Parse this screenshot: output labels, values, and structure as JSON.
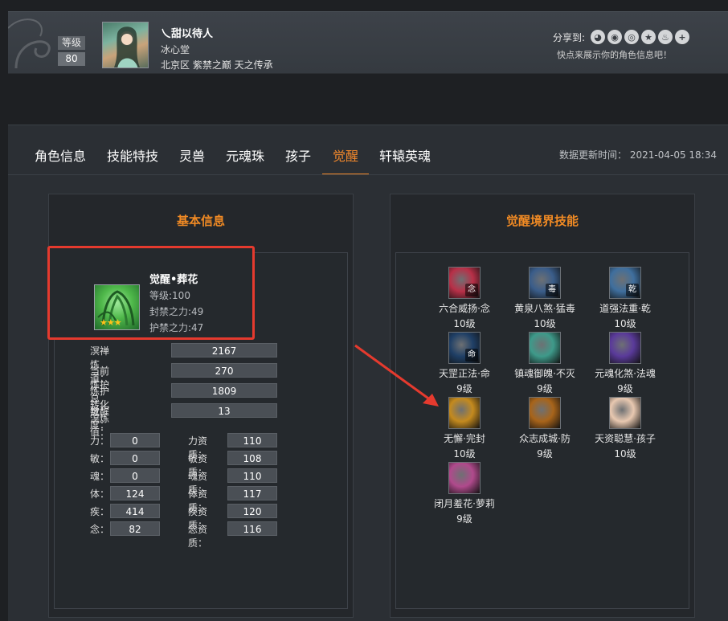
{
  "header": {
    "level_label": "等级",
    "level_value": "80",
    "player_name": "乀甜以待人",
    "guild": "冰心堂",
    "server": "北京区 紫禁之巅 天之传承",
    "share_label": "分享到:",
    "share_icons": [
      "wechat-icon",
      "qq-icon",
      "weibo-icon",
      "qzone-icon",
      "tieba-icon",
      "more-icon"
    ],
    "share_tip": "快点来展示你的角色信息吧！"
  },
  "tabs": [
    {
      "label": "角色信息"
    },
    {
      "label": "技能特技"
    },
    {
      "label": "灵兽"
    },
    {
      "label": "元魂珠"
    },
    {
      "label": "孩子"
    },
    {
      "label": "觉醒",
      "active": true
    },
    {
      "label": "轩辕英魂"
    }
  ],
  "update_time": "数据更新时间： 2021-04-05 18:34",
  "basic": {
    "title": "基本信息",
    "awaken_name": "觉醒•葬花",
    "awaken_level": "等级:100",
    "seal_power": "封禁之力:49",
    "guard_power": "护禁之力:47",
    "stats": [
      {
        "label": "溟禅炼道：",
        "value": "2167"
      },
      {
        "label": "当前炼护总数：",
        "value": "270"
      },
      {
        "label": "炼护转化溟炼值：",
        "value": "1809"
      },
      {
        "label": "觉醒度：",
        "value": "13"
      }
    ],
    "attrs_left": [
      {
        "label": "力：",
        "value": "0"
      },
      {
        "label": "敏：",
        "value": "0"
      },
      {
        "label": "魂：",
        "value": "0"
      },
      {
        "label": "体：",
        "value": "124"
      },
      {
        "label": "疾：",
        "value": "414"
      },
      {
        "label": "念：",
        "value": "82"
      }
    ],
    "attrs_right": [
      {
        "label": "力资质：",
        "value": "110"
      },
      {
        "label": "敏资质：",
        "value": "108"
      },
      {
        "label": "魂资质：",
        "value": "110"
      },
      {
        "label": "体资质：",
        "value": "117"
      },
      {
        "label": "疾资质：",
        "value": "120"
      },
      {
        "label": "念资质：",
        "value": "116"
      }
    ]
  },
  "skills": {
    "title": "觉醒境界技能",
    "items": [
      {
        "name": "六合威扬·念",
        "level": "10级",
        "glyph": "念",
        "color": "#b83048"
      },
      {
        "name": "黄泉八煞·猛毒",
        "level": "10级",
        "glyph": "毒",
        "color": "#3a5d8a"
      },
      {
        "name": "道强法重·乾",
        "level": "10级",
        "glyph": "乾",
        "color": "#3f6f9e"
      },
      {
        "name": "天罡正法·命",
        "level": "9级",
        "glyph": "命",
        "color": "#1f3f66"
      },
      {
        "name": "镇魂御魄·不灭",
        "level": "9级",
        "glyph": "",
        "color": "#3e9a8a"
      },
      {
        "name": "元魂化煞·法魂",
        "level": "9级",
        "glyph": "",
        "color": "#5a3a9a"
      },
      {
        "name": "无懈·完封",
        "level": "10级",
        "glyph": "",
        "color": "#c48a1e"
      },
      {
        "name": "众志成城·防",
        "level": "9级",
        "glyph": "",
        "color": "#a8641a"
      },
      {
        "name": "天资聪慧·孩子",
        "level": "10级",
        "glyph": "",
        "color": "#e8c8b0"
      },
      {
        "name": "闭月羞花·萝莉",
        "level": "9级",
        "glyph": "",
        "color": "#b04a8c"
      }
    ]
  }
}
